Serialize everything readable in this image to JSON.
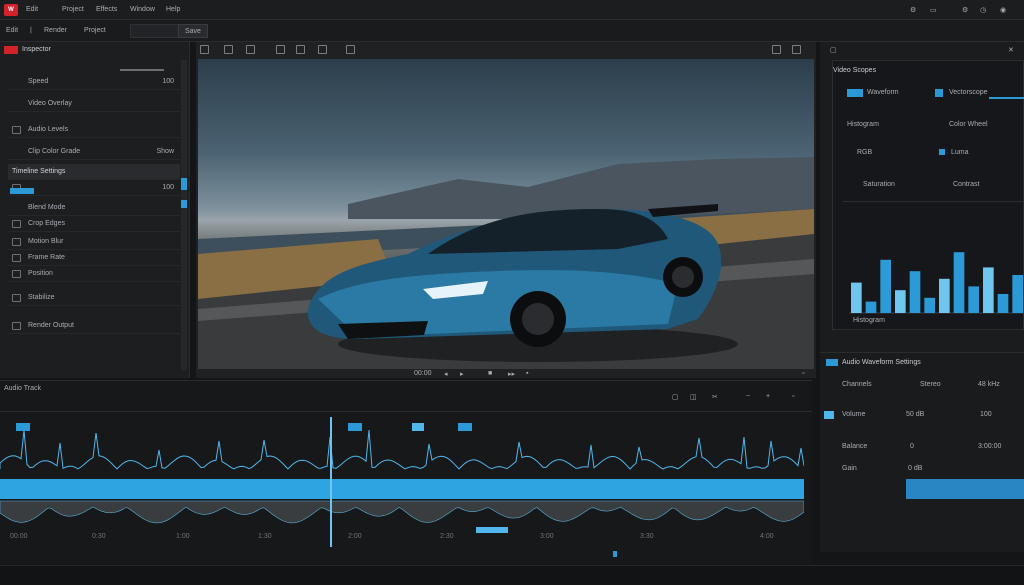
{
  "menubar": {
    "logo_text": "W",
    "items": [
      "Edit",
      "Project",
      "Effects",
      "Window",
      "Help"
    ],
    "tabs": [
      "Edit",
      "Render"
    ],
    "right_label": "Save"
  },
  "left_panel": {
    "title": "Inspector",
    "rows": [
      {
        "label": "Speed",
        "value": "100"
      },
      {
        "label": "Video Overlay",
        "value": ""
      },
      {
        "label": "Audio Levels",
        "value": ""
      },
      {
        "label": "Clip Color Grade",
        "value": "Show"
      },
      {
        "label": "Timeline Settings",
        "value": ""
      },
      {
        "label": "Opacity",
        "value": "100"
      },
      {
        "label": "Blend Mode",
        "value": ""
      },
      {
        "label": "Crop Edges",
        "value": ""
      },
      {
        "label": "Motion Blur",
        "value": ""
      },
      {
        "label": "Frame Rate",
        "value": ""
      },
      {
        "label": "Position",
        "value": ""
      },
      {
        "label": "Stabilize",
        "value": ""
      },
      {
        "label": "Render Output",
        "value": ""
      }
    ]
  },
  "viewer": {
    "timecode": "00:00",
    "transport": [
      "prev",
      "play",
      "next"
    ]
  },
  "right_panel": {
    "title": "Video Scopes",
    "rows": [
      {
        "left": "Waveform",
        "right": "Vectorscope"
      },
      {
        "left": "Histogram",
        "right": "Color Wheel"
      },
      {
        "left": "RGB",
        "right": "Luma"
      },
      {
        "left": "Saturation",
        "right": "Contrast"
      }
    ],
    "chart_label": "Histogram"
  },
  "props": {
    "title": "Audio Waveform Settings",
    "rows": [
      {
        "label": "Channels",
        "value": "Stereo",
        "extra": "48 kHz"
      },
      {
        "label": "Volume",
        "value": "50 dB",
        "extra": "100"
      },
      {
        "label": "Balance",
        "value": "0",
        "extra": "3:00:00"
      },
      {
        "label": "Gain",
        "value": "0 dB",
        "extra": ""
      }
    ]
  },
  "timeline": {
    "track_label": "Audio Track",
    "time_marks": [
      "00:00",
      "0:30",
      "1:00",
      "1:30",
      "2:00",
      "2:30",
      "3:00",
      "3:30",
      "4:00"
    ]
  },
  "chart_data": {
    "type": "bar",
    "values": [
      40,
      15,
      70,
      30,
      55,
      20,
      45,
      80,
      35,
      60,
      25,
      50
    ]
  },
  "colors": {
    "accent": "#2d9ad8",
    "waveform": "#4fb7ec",
    "brand": "#d2232a"
  }
}
